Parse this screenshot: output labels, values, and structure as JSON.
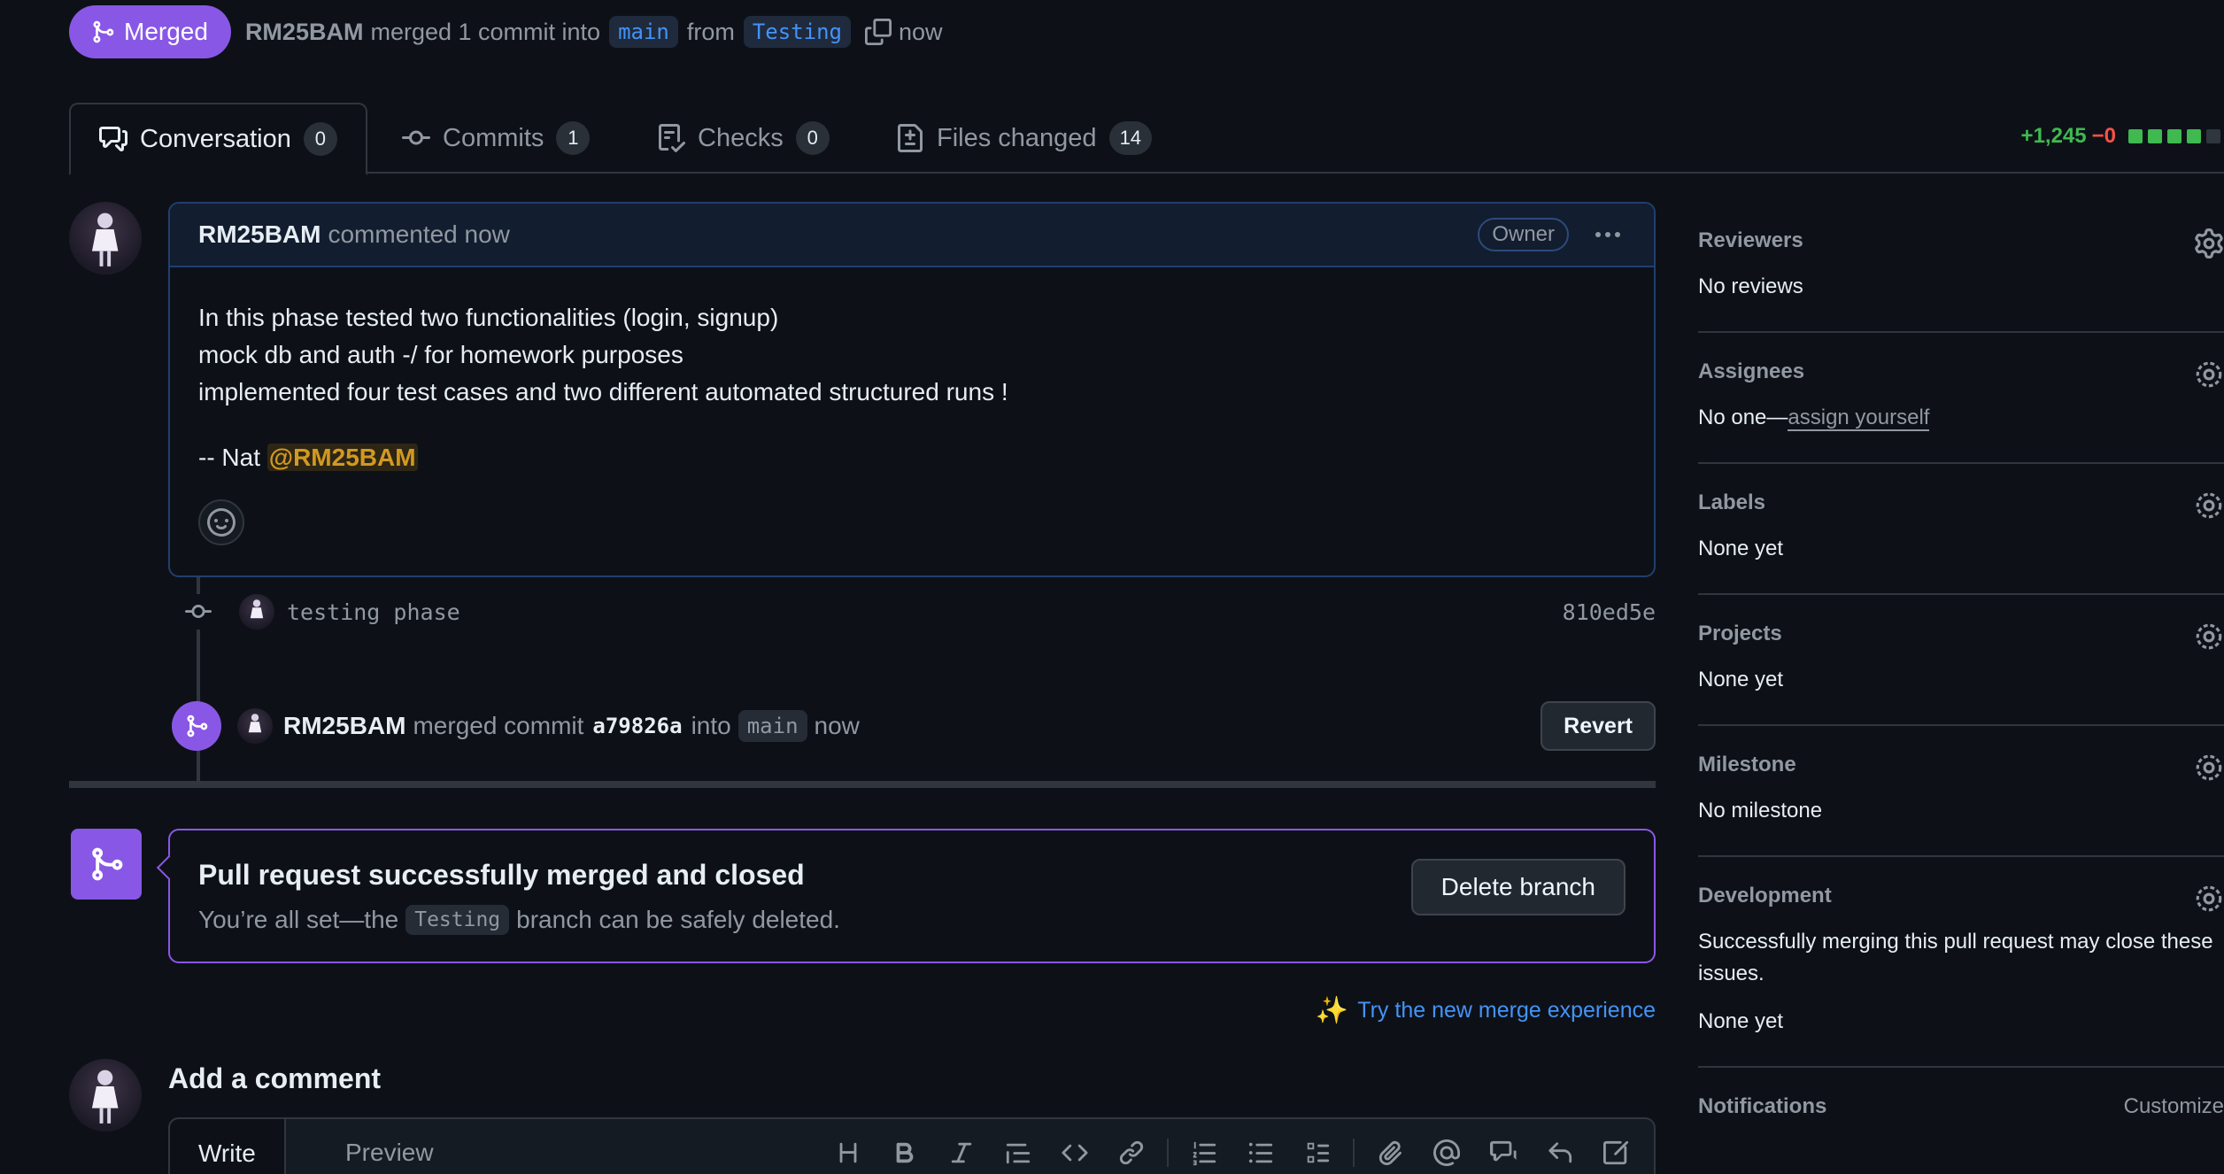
{
  "header": {
    "state_label": "Merged",
    "author": "RM25BAM",
    "action_text": "merged 1 commit into",
    "base_branch": "main",
    "from_text": "from",
    "head_branch": "Testing",
    "time": "now"
  },
  "tabs": [
    {
      "label": "Conversation",
      "count": "0",
      "icon": "comment-discussion-icon",
      "active": true
    },
    {
      "label": "Commits",
      "count": "1",
      "icon": "git-commit-icon"
    },
    {
      "label": "Checks",
      "count": "0",
      "icon": "checklist-icon"
    },
    {
      "label": "Files changed",
      "count": "14",
      "icon": "file-diff-icon"
    }
  ],
  "diffstat": {
    "additions": "+1,245",
    "deletions": "−0",
    "blocks_green": 4,
    "blocks_total": 5,
    "add_color": "#3fb950",
    "del_color": "#f85149"
  },
  "comment": {
    "author": "RM25BAM",
    "meta": "commented now",
    "role_badge": "Owner",
    "lines": [
      "In this phase tested two functionalities (login, signup)",
      "mock db and auth -/ for homework purposes",
      "implemented four test cases and two different automated structured runs !"
    ],
    "signature_prefix": "-- Nat ",
    "mention": "@RM25BAM"
  },
  "commit": {
    "message": "testing phase",
    "sha": "810ed5e"
  },
  "merge_event": {
    "author": "RM25BAM",
    "text": "merged commit",
    "sha": "a79826a",
    "into_text": "into",
    "branch": "main",
    "time": "now",
    "revert_label": "Revert"
  },
  "merged_box": {
    "title": "Pull request successfully merged and closed",
    "sub_prefix": "You’re all set—the",
    "branch": "Testing",
    "sub_suffix": "branch can be safely deleted.",
    "delete_label": "Delete branch"
  },
  "try_merge": {
    "icon": "✨",
    "label": "Try the new merge experience"
  },
  "add_comment": {
    "title": "Add a comment",
    "write_tab": "Write",
    "preview_tab": "Preview",
    "toolbar_icons": [
      "heading-icon",
      "bold-icon",
      "italic-icon",
      "quote-icon",
      "code-icon",
      "link-icon",
      "ordered-list-icon",
      "unordered-list-icon",
      "task-list-icon",
      "attach-icon",
      "mention-icon",
      "cross-reference-icon",
      "reply-icon",
      "fullscreen-icon"
    ]
  },
  "sidebar": {
    "reviewers": {
      "title": "Reviewers",
      "value": "No reviews"
    },
    "assignees": {
      "title": "Assignees",
      "value_prefix": "No one—",
      "link": "assign yourself"
    },
    "labels": {
      "title": "Labels",
      "value": "None yet"
    },
    "projects": {
      "title": "Projects",
      "value": "None yet"
    },
    "milestone": {
      "title": "Milestone",
      "value": "No milestone"
    },
    "development": {
      "title": "Development",
      "description": "Successfully merging this pull request may close these issues.",
      "value": "None yet"
    },
    "notifications": {
      "title": "Notifications",
      "action": "Customize"
    }
  },
  "colors": {
    "background": "#0d1117",
    "merged_purple": "#8957e5",
    "link_blue": "#4493f8",
    "muted": "#9198a1"
  }
}
